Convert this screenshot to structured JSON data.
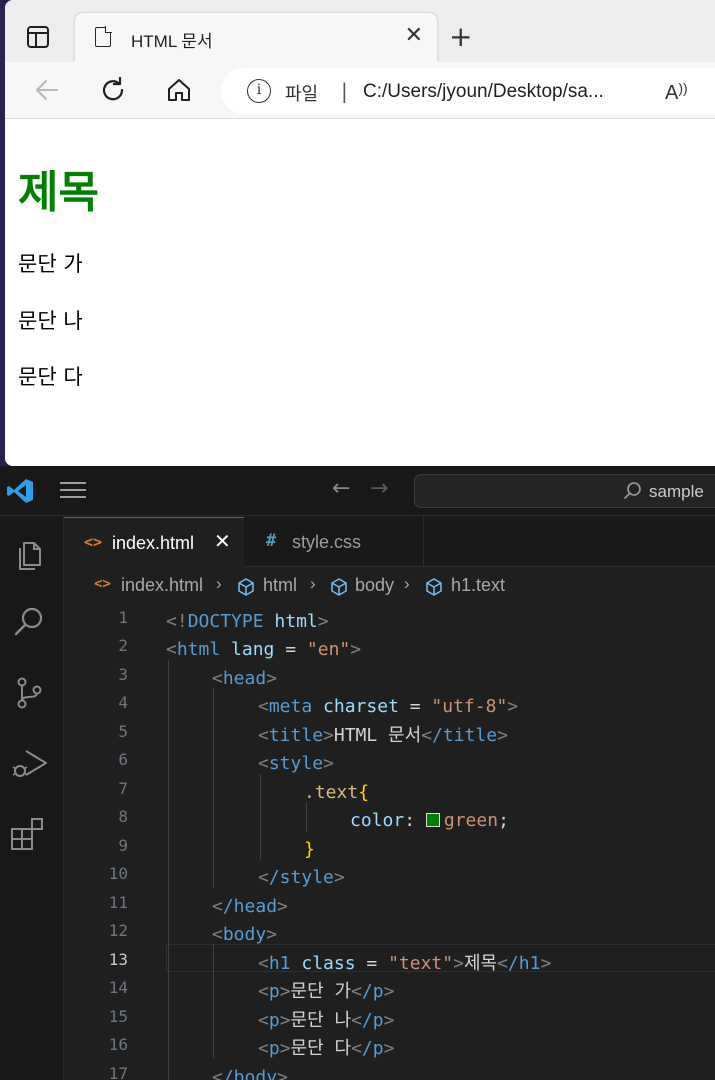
{
  "browser": {
    "tab_title": "HTML 문서",
    "tab_close": "✕",
    "new_tab": "+",
    "address": {
      "scheme_label": "파일",
      "separator": "|",
      "url": "C:/Users/jyoun/Desktop/sa..."
    },
    "icons": [
      "sidebar-toggle-icon",
      "document-icon",
      "close-icon",
      "plus-icon",
      "back-arrow-icon",
      "reload-icon",
      "home-icon",
      "info-icon",
      "read-aloud-icon"
    ]
  },
  "page": {
    "heading": "제목",
    "heading_color": "#008000",
    "paragraphs": [
      "문단 가",
      "문단 나",
      "문단 다"
    ]
  },
  "vscode": {
    "search_text": "sample",
    "tabs": [
      {
        "label": "index.html",
        "icon": "<>",
        "active": true,
        "close": "✕"
      },
      {
        "label": "style.css",
        "icon": "#",
        "active": false
      }
    ],
    "breadcrumb": [
      "index.html",
      "html",
      "body",
      "h1.text"
    ],
    "line_numbers": [
      "1",
      "2",
      "3",
      "4",
      "5",
      "6",
      "7",
      "8",
      "9",
      "10",
      "11",
      "12",
      "13",
      "14",
      "15",
      "16",
      "17"
    ],
    "active_line": "13",
    "code": {
      "l1": {
        "open": "<!",
        "doctype": "DOCTYPE",
        "html": "html",
        "close": ">"
      },
      "l2": {
        "lt": "<",
        "tag": "html",
        "attr": "lang",
        "eq": " = ",
        "val": "\"en\"",
        "gt": ">"
      },
      "l3": {
        "tag": "head"
      },
      "l4": {
        "tag": "meta",
        "attr": "charset",
        "eq": " = ",
        "val": "\"utf-8\""
      },
      "l5": {
        "tag": "title",
        "text": "HTML 문서",
        "ctag": "/title"
      },
      "l6": {
        "tag": "style"
      },
      "l7": {
        "selector": ".text",
        "brace": "{"
      },
      "l8": {
        "prop": "color",
        "colon": ": ",
        "value": "green",
        "semi": ";",
        "swatch": "#008000"
      },
      "l9": {
        "brace": "}"
      },
      "l10": {
        "tag": "/style"
      },
      "l11": {
        "tag": "/head"
      },
      "l12": {
        "tag": "body"
      },
      "l13": {
        "tag": "h1",
        "attr": "class",
        "eq": " = ",
        "val": "\"text\"",
        "text": "제목",
        "ctag": "/h1"
      },
      "l14": {
        "tag": "p",
        "text": "문단 가",
        "ctag": "/p"
      },
      "l15": {
        "tag": "p",
        "text": "문단 나",
        "ctag": "/p"
      },
      "l16": {
        "tag": "p",
        "text": "문단 다",
        "ctag": "/p"
      },
      "l17": {
        "tag": "/body"
      }
    }
  }
}
